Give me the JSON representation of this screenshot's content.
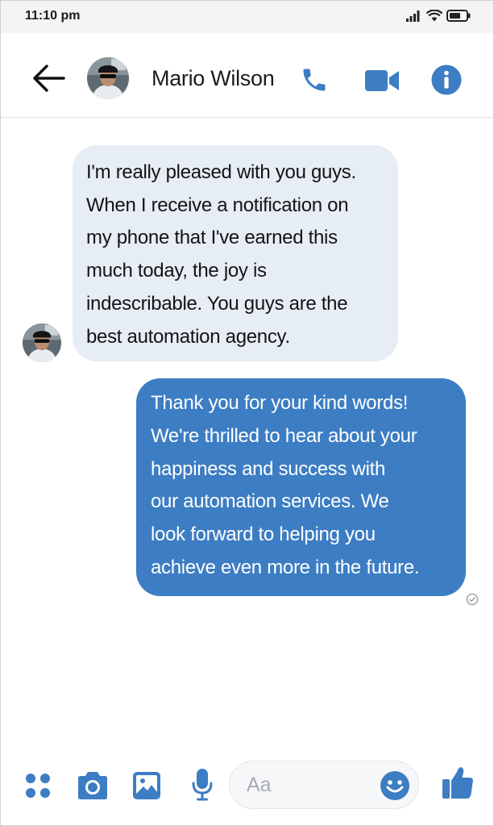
{
  "status_bar": {
    "time": "11:10 pm",
    "icons": [
      "signal-icon",
      "wifi-icon",
      "battery-icon"
    ]
  },
  "header": {
    "contact_name": "Mario Wilson",
    "icons": [
      "back-arrow-icon",
      "phone-icon",
      "video-camera-icon",
      "info-icon"
    ]
  },
  "messages": [
    {
      "direction": "incoming",
      "lines": [
        "I'm really pleased with you guys.",
        "When I receive a notification on",
        "my phone that I've earned this",
        "much today, the joy is",
        "indescribable. You guys are the",
        "best automation agency."
      ]
    },
    {
      "direction": "outgoing",
      "lines": [
        "Thank you for your kind words!",
        "We're thrilled to hear about your",
        "happiness and success with",
        "our automation services. We",
        "look forward to helping you",
        "achieve even more in the future."
      ],
      "status_icon": "seen-check-icon"
    }
  ],
  "composer": {
    "placeholder": "Aa",
    "icons": [
      "apps-icon",
      "camera-icon",
      "gallery-icon",
      "microphone-icon",
      "emoji-icon",
      "thumbs-up-icon"
    ]
  },
  "colors": {
    "accent": "#3c7dc3",
    "incoming_bubble": "#e7edf5",
    "outgoing_bubble": "#3c7dc3",
    "status_bar_bg": "#f4f4f6"
  }
}
